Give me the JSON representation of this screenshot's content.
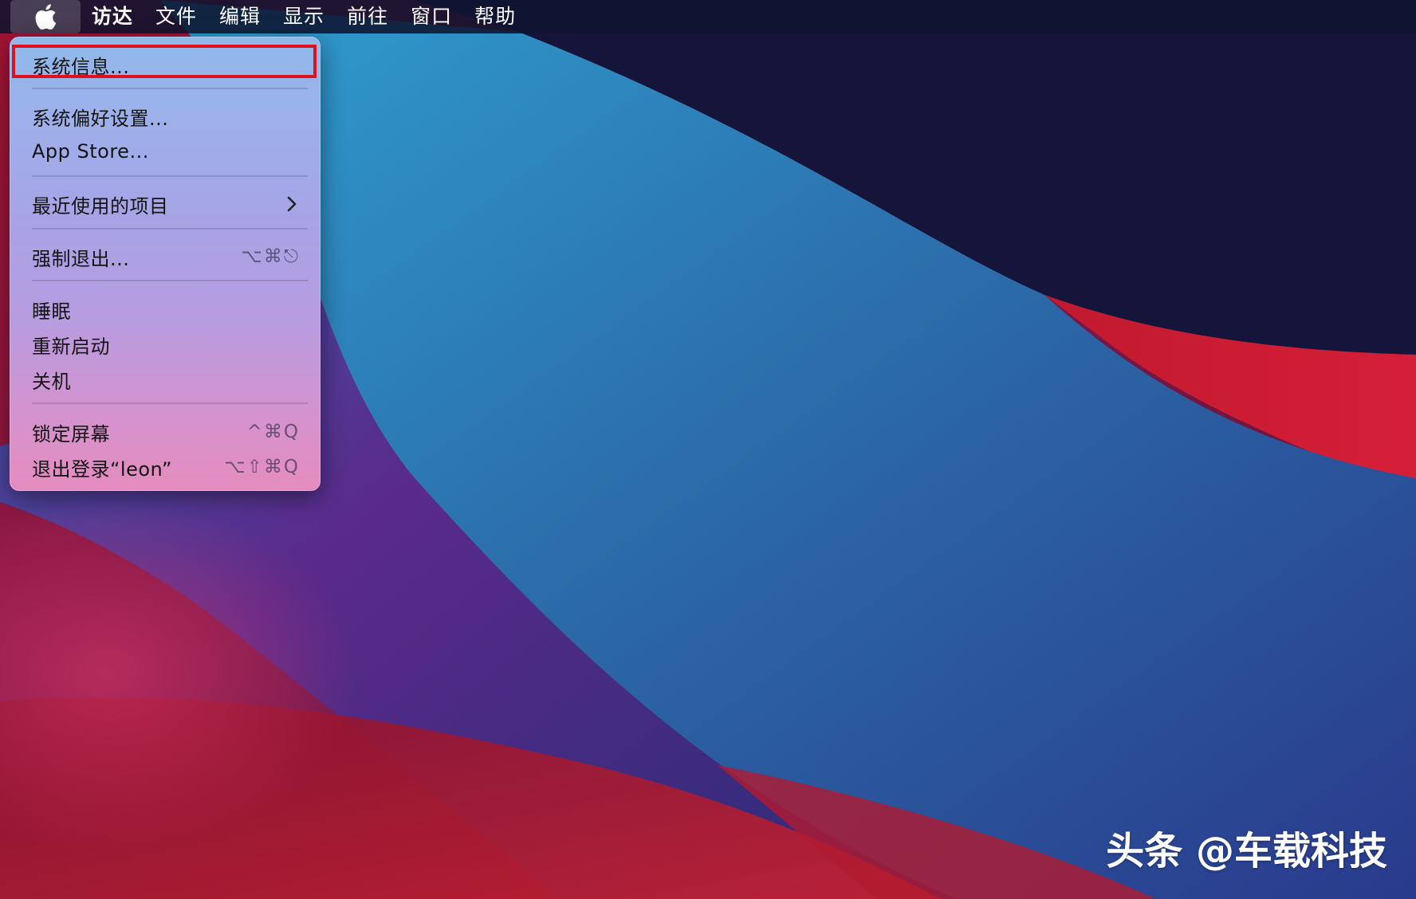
{
  "menubar": {
    "apple_icon": "apple-logo-icon",
    "items": [
      {
        "label": "访达"
      },
      {
        "label": "文件"
      },
      {
        "label": "编辑"
      },
      {
        "label": "显示"
      },
      {
        "label": "前往"
      },
      {
        "label": "窗口"
      },
      {
        "label": "帮助"
      }
    ]
  },
  "apple_menu": {
    "items": [
      {
        "label": "系统信息...",
        "shortcut": ""
      },
      {
        "label": "系统偏好设置...",
        "shortcut": ""
      },
      {
        "label": "App Store...",
        "shortcut": ""
      },
      {
        "label": "最近使用的项目",
        "shortcut": "",
        "submenu_icon": "chevron-right-icon"
      },
      {
        "label": "强制退出...",
        "shortcut": "⌥⌘⎋"
      },
      {
        "label": "睡眠",
        "shortcut": ""
      },
      {
        "label": "重新启动",
        "shortcut": ""
      },
      {
        "label": "关机",
        "shortcut": ""
      },
      {
        "label": "锁定屏幕",
        "shortcut": "^⌘Q"
      },
      {
        "label": "退出登录“leon”",
        "shortcut": "⌥⇧⌘Q"
      }
    ],
    "highlighted_item": "系统信息...",
    "highlight_color": "#e0101c"
  },
  "watermark": {
    "text": "头条 @车载科技"
  },
  "colors": {
    "menubar_bg": "#0e1430",
    "wallpaper_dark": "#15143a",
    "wallpaper_blue": "#2a86b8",
    "wallpaper_red": "#c8182c"
  }
}
